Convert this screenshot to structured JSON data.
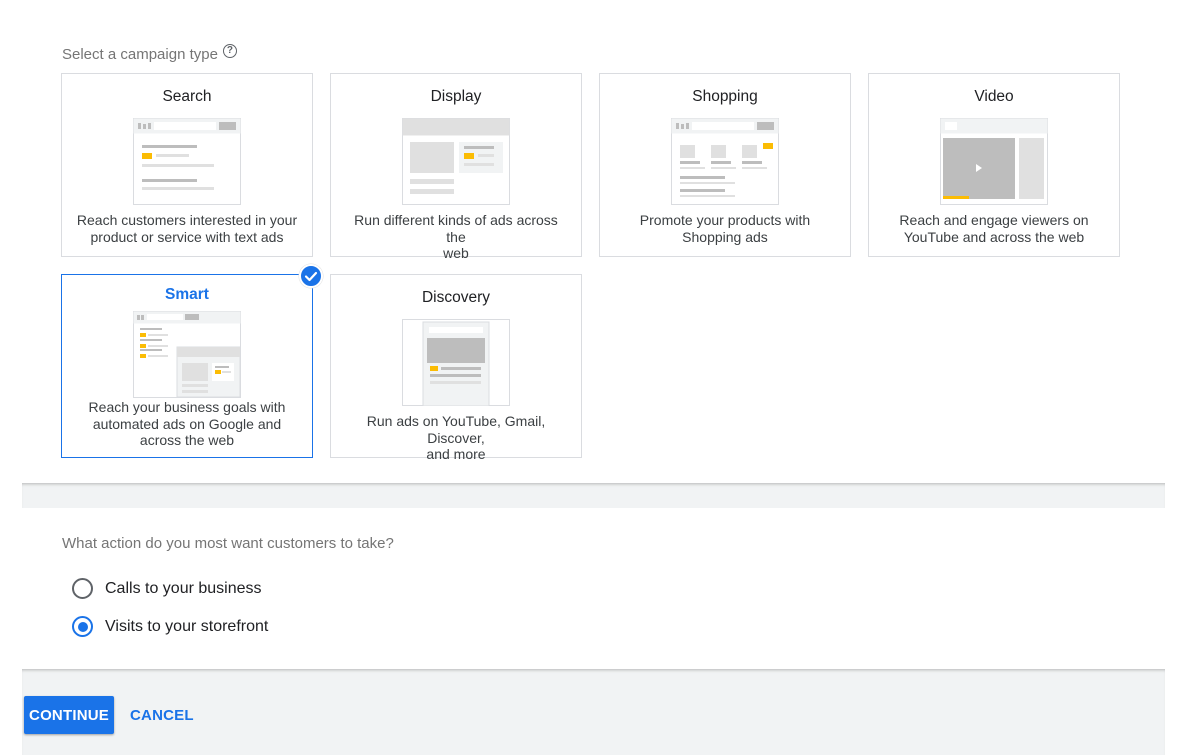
{
  "campaign_type": {
    "title": "Select a campaign type",
    "help_glyph": "?",
    "cards": [
      {
        "title": "Search",
        "desc_lines": [
          "Reach customers interested in your",
          "product or service with text ads"
        ]
      },
      {
        "title": "Display",
        "desc_lines": [
          "Run different kinds of ads across the",
          "web"
        ]
      },
      {
        "title": "Shopping",
        "desc_lines": [
          "Promote your products with",
          "Shopping ads"
        ]
      },
      {
        "title": "Video",
        "desc_lines": [
          "Reach and engage viewers on",
          "YouTube and across the web"
        ]
      },
      {
        "title": "Smart",
        "desc_lines": [
          "Reach your business goals with",
          "automated ads on Google and",
          "across the web"
        ],
        "selected": true
      },
      {
        "title": "Discovery",
        "desc_lines": [
          "Run ads on YouTube, Gmail, Discover,",
          "and more"
        ]
      }
    ]
  },
  "goal": {
    "question": "What action do you most want customers to take?",
    "options": [
      {
        "label": "Calls to your business",
        "checked": false
      },
      {
        "label": "Visits to your storefront",
        "checked": true
      }
    ]
  },
  "footer": {
    "continue_label": "CONTINUE",
    "cancel_label": "CANCEL"
  },
  "colors": {
    "accent": "#1a73e8",
    "highlight": "#fbbc04",
    "border": "#dadce0"
  }
}
